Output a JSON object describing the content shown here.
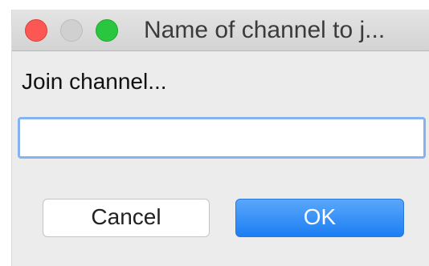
{
  "window": {
    "title": "Name of channel to j..."
  },
  "dialog": {
    "prompt": "Join channel...",
    "input": {
      "value": "",
      "placeholder": ""
    },
    "buttons": {
      "cancel_label": "Cancel",
      "ok_label": "OK"
    }
  },
  "colors": {
    "close": "#fc5753",
    "minimize": "#d0d0d0",
    "zoom": "#2bc63f",
    "accent": "#1c7ef2",
    "focus_ring": "#86b3ef"
  }
}
